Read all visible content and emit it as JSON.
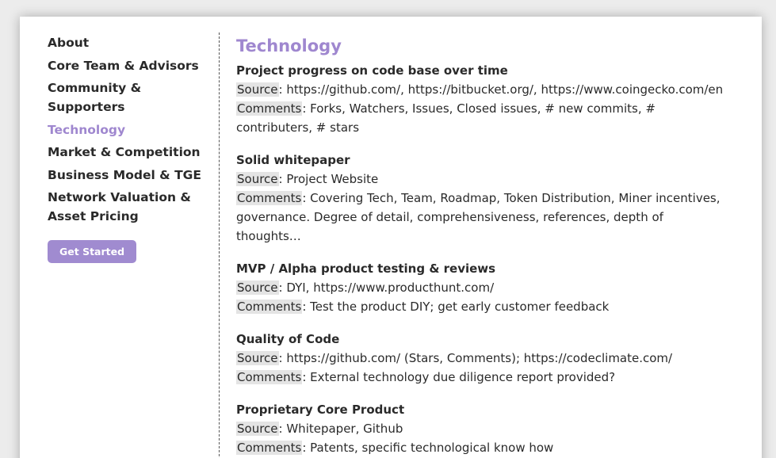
{
  "sidebar": {
    "items": [
      {
        "label": "About"
      },
      {
        "label": "Core Team & Advisors"
      },
      {
        "label": "Community & Supporters"
      },
      {
        "label": "Technology"
      },
      {
        "label": "Market & Competition"
      },
      {
        "label": "Business Model & TGE"
      },
      {
        "label": "Network Valuation &"
      },
      {
        "label": "Asset Pricing"
      }
    ],
    "button_label": "Get Started"
  },
  "content": {
    "title": "Technology",
    "source_label": "Source",
    "comments_label": "Comments",
    "sections": [
      {
        "title": "Project progress on code base over time",
        "source": ": https://github.com/, https://bitbucket.org/, https://www.coingecko.com/en",
        "comments": ": Forks, Watchers, Issues, Closed issues, # new commits, # contributers, # stars"
      },
      {
        "title": "Solid whitepaper",
        "source": ": Project Website",
        "comments": ": Covering Tech, Team, Roadmap, Token Distribution, Miner incentives, governance. Degree of detail, comprehensiveness, references, depth of thoughts…"
      },
      {
        "title": "MVP / Alpha product testing & reviews",
        "source": ": DYI, https://www.producthunt.com/",
        "comments": ": Test the product DIY; get early customer feedback"
      },
      {
        "title": "Quality of Code",
        "source": ": https://github.com/ (Stars, Comments); https://codeclimate.com/",
        "comments": ": External technology due diligence report provided?"
      },
      {
        "title": "Proprietary Core Product",
        "source": ": Whitepaper, Github",
        "comments": ": Patents, specific technological know how"
      }
    ]
  },
  "colors": {
    "accent": "#9f87cf",
    "button": "#a08bd0",
    "label_highlight": "#e4e4e4"
  }
}
